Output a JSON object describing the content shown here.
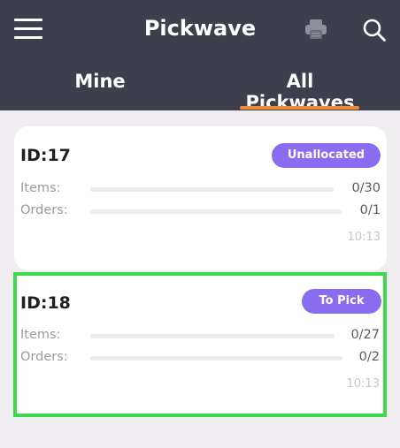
{
  "header": {
    "title": "Pickwave",
    "icons": {
      "menu": "hamburger-menu-icon",
      "print": "printer-icon",
      "search": "search-icon"
    },
    "tabs": [
      {
        "label": "Mine",
        "active": false
      },
      {
        "label": "All Pickwaves",
        "active": true
      }
    ],
    "accent_color": "#f08a34",
    "background_color": "#3d3f4d"
  },
  "pickwaves": [
    {
      "id": "ID:17",
      "status": "Unallocated",
      "items_label": "Items:",
      "items_count": "0/30",
      "items_progress": 0,
      "orders_label": "Orders:",
      "orders_count": "0/1",
      "orders_progress": 0,
      "time": "10:13",
      "selected": false
    },
    {
      "id": "ID:18",
      "status": "To Pick",
      "items_label": "Items:",
      "items_count": "0/27",
      "items_progress": 0,
      "orders_label": "Orders:",
      "orders_count": "0/2",
      "orders_progress": 0,
      "time": "10:13",
      "selected": true
    }
  ],
  "colors": {
    "status_badge": "#8a6cf0",
    "selection_border": "#3fd84a"
  }
}
